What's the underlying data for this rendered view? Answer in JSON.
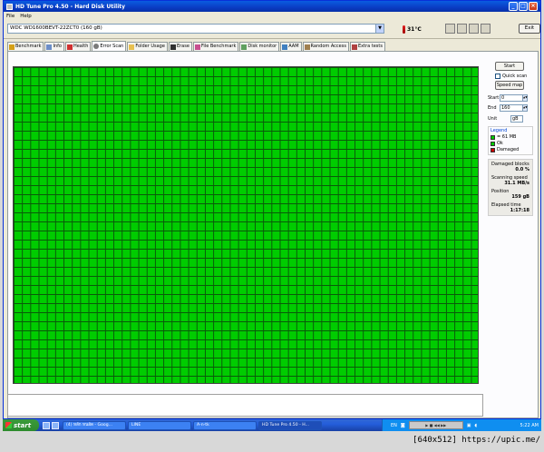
{
  "window": {
    "title": "HD Tune Pro 4.50 - Hard Disk Utility",
    "controls": [
      "_",
      "□",
      "×"
    ]
  },
  "menu": [
    "File",
    "Help"
  ],
  "toolbar": {
    "drive": "WDC WD1600BEVT-22ZCT0   (160 gB)",
    "temperature": "31°C",
    "exit_label": "Exit"
  },
  "tabs": [
    {
      "label": "Benchmark",
      "icon": "benchmark-icon"
    },
    {
      "label": "Info",
      "icon": "info-icon"
    },
    {
      "label": "Health",
      "icon": "health-icon"
    },
    {
      "label": "Error Scan",
      "icon": "error-scan-icon"
    },
    {
      "label": "Folder Usage",
      "icon": "folder-icon"
    },
    {
      "label": "Erase",
      "icon": "erase-icon"
    },
    {
      "label": "File Benchmark",
      "icon": "file-benchmark-icon"
    },
    {
      "label": "Disk monitor",
      "icon": "disk-monitor-icon"
    },
    {
      "label": "AAM",
      "icon": "aam-icon"
    },
    {
      "label": "Random Access",
      "icon": "random-access-icon"
    },
    {
      "label": "Extra tests",
      "icon": "extra-tests-icon"
    }
  ],
  "active_tab": "Error Scan",
  "scan_panel": {
    "start_label": "Start",
    "quick_scan_label": "Quick scan",
    "quick_scan_checked": false,
    "speed_map_label": "Speed map",
    "start_field_label": "Start",
    "start_value": "0",
    "end_field_label": "End",
    "end_value": "160",
    "unit_label": "Unit",
    "unit_value": "gB"
  },
  "legend": {
    "title": "Legend",
    "items": [
      {
        "label": "= 61 MB",
        "color": "#00cc00"
      },
      {
        "label": "Ok",
        "color": "#00cc00"
      },
      {
        "label": "Damaged",
        "color": "#cc0000"
      }
    ]
  },
  "stats": {
    "damaged_blocks_label": "Damaged blocks",
    "damaged_blocks_value": "0.0 %",
    "scanning_speed_label": "Scanning speed",
    "scanning_speed_value": "31.1 MB/s",
    "position_label": "Position",
    "position_value": "159 gB",
    "elapsed_label": "Elapsed time",
    "elapsed_value": "1:17:18"
  },
  "block_map": {
    "status": "ok",
    "color": "#00cc00",
    "damaged_percent": 0.0
  },
  "taskbar": {
    "start_label": "start",
    "tasks": [
      {
        "label": "(4) หลัก หนอัด - Goog...",
        "active": false
      },
      {
        "label": "LINE",
        "active": false
      },
      {
        "label": "A-n-tk",
        "active": false
      },
      {
        "label": "HD Tune Pro 4.50 - H...",
        "active": true
      }
    ],
    "language": "EN",
    "clock": "5:22 AM"
  },
  "watermark": "[640x512] https://upic.me/"
}
